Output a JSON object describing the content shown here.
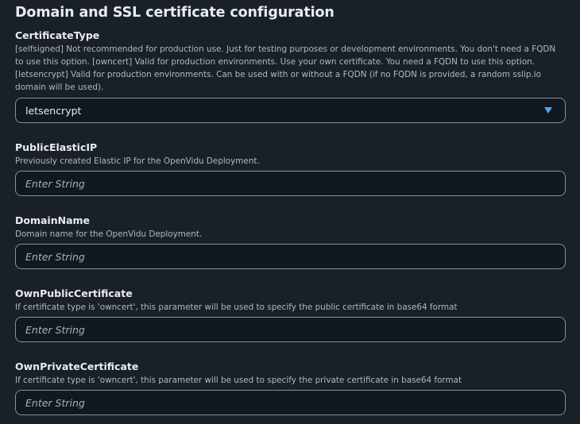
{
  "section": {
    "title": "Domain and SSL certificate configuration"
  },
  "fields": [
    {
      "label": "CertificateType",
      "description": "[selfsigned] Not recommended for production use. Just for testing purposes or development environments. You don't need a FQDN to use this option. [owncert] Valid for production environments. Use your own certificate. You need a FQDN to use this option. [letsencrypt] Valid for production environments. Can be used with or without a FQDN (if no FQDN is provided, a random sslip.io domain will be used).",
      "value": "letsencrypt",
      "icon": "caret-down-icon",
      "accent": "#44a7ff"
    },
    {
      "label": "PublicElasticIP",
      "description": "Previously created Elastic IP for the OpenVidu Deployment.",
      "value": "",
      "placeholder": "Enter String"
    },
    {
      "label": "DomainName",
      "description": "Domain name for the OpenVidu Deployment.",
      "value": "",
      "placeholder": "Enter String"
    },
    {
      "label": "OwnPublicCertificate",
      "description": "If certificate type is 'owncert', this parameter will be used to specify the public certificate in base64 format",
      "value": "",
      "placeholder": "Enter String"
    },
    {
      "label": "OwnPrivateCertificate",
      "description": "If certificate type is 'owncert', this parameter will be used to specify the private certificate in base64 format",
      "value": "",
      "placeholder": "Enter String"
    }
  ]
}
